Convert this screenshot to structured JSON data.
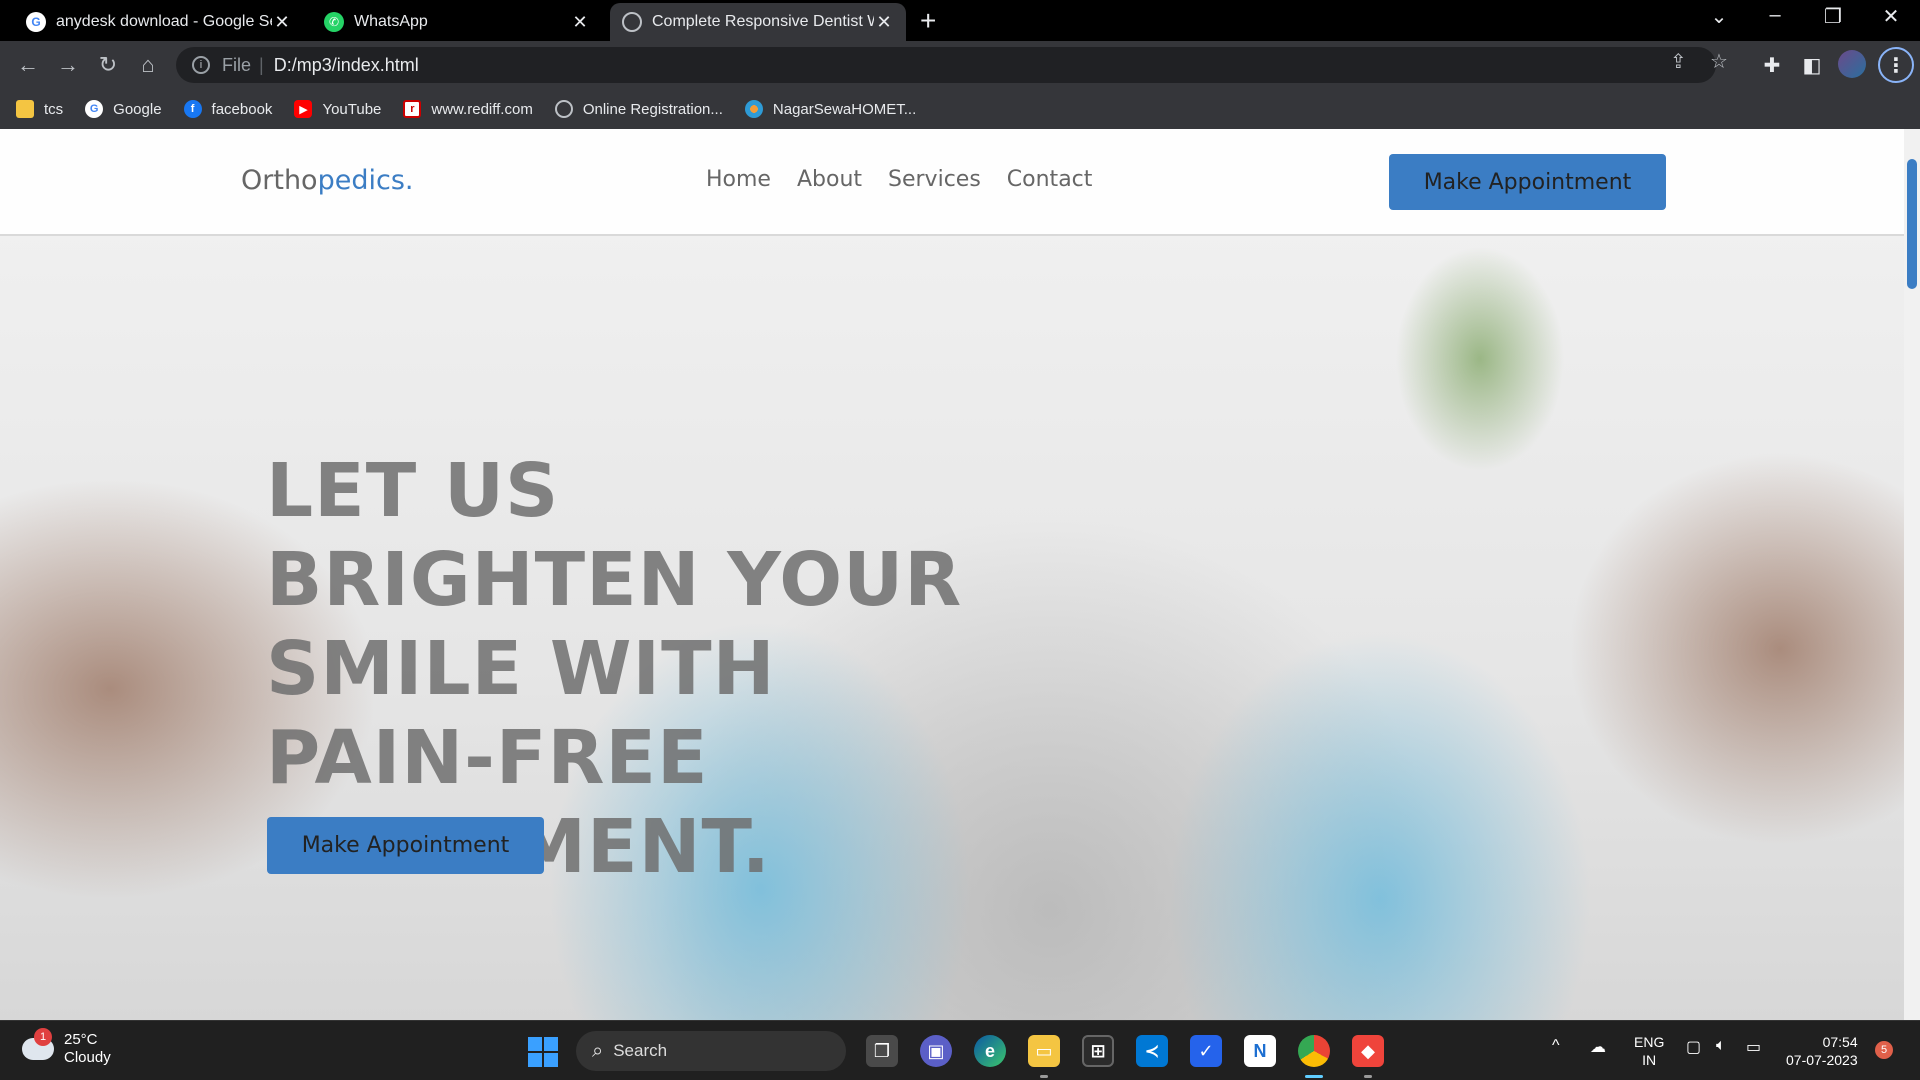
{
  "browser": {
    "tabs": [
      {
        "title": "anydesk download - Google Sear",
        "favicon": "google-icon"
      },
      {
        "title": "WhatsApp",
        "favicon": "whatsapp-icon"
      },
      {
        "title": "Complete Responsive Dentist We",
        "favicon": "globe-icon",
        "active": true
      }
    ],
    "address": {
      "scheme": "File",
      "url": "D:/mp3/index.html"
    },
    "bookmarks": [
      {
        "label": "tcs",
        "icon": "folder-icon"
      },
      {
        "label": "Google",
        "icon": "google-icon"
      },
      {
        "label": "facebook",
        "icon": "facebook-icon"
      },
      {
        "label": "YouTube",
        "icon": "youtube-icon"
      },
      {
        "label": "www.rediff.com",
        "icon": "rediff-icon"
      },
      {
        "label": "Online Registration...",
        "icon": "globe-icon"
      },
      {
        "label": "NagarSewaHOMET...",
        "icon": "nagarsewa-icon"
      }
    ]
  },
  "site": {
    "logo": {
      "part1": "Ortho",
      "part2": "pedics."
    },
    "nav": [
      "Home",
      "About",
      "Services",
      "Contact"
    ],
    "header_button": "Make Appointment",
    "hero": {
      "title": "LET US BRIGHTEN YOUR SMILE WITH PAIN-FREE MOVEMENT.",
      "button": "Make Appointment"
    },
    "colors": {
      "accent": "#3b7dc4"
    }
  },
  "taskbar": {
    "weather": {
      "temp": "25°C",
      "condition": "Cloudy",
      "badge": "1"
    },
    "search_label": "Search",
    "language": {
      "line1": "ENG",
      "line2": "IN"
    },
    "clock": {
      "time": "07:54",
      "date": "07-07-2023"
    },
    "notification_count": "5"
  }
}
